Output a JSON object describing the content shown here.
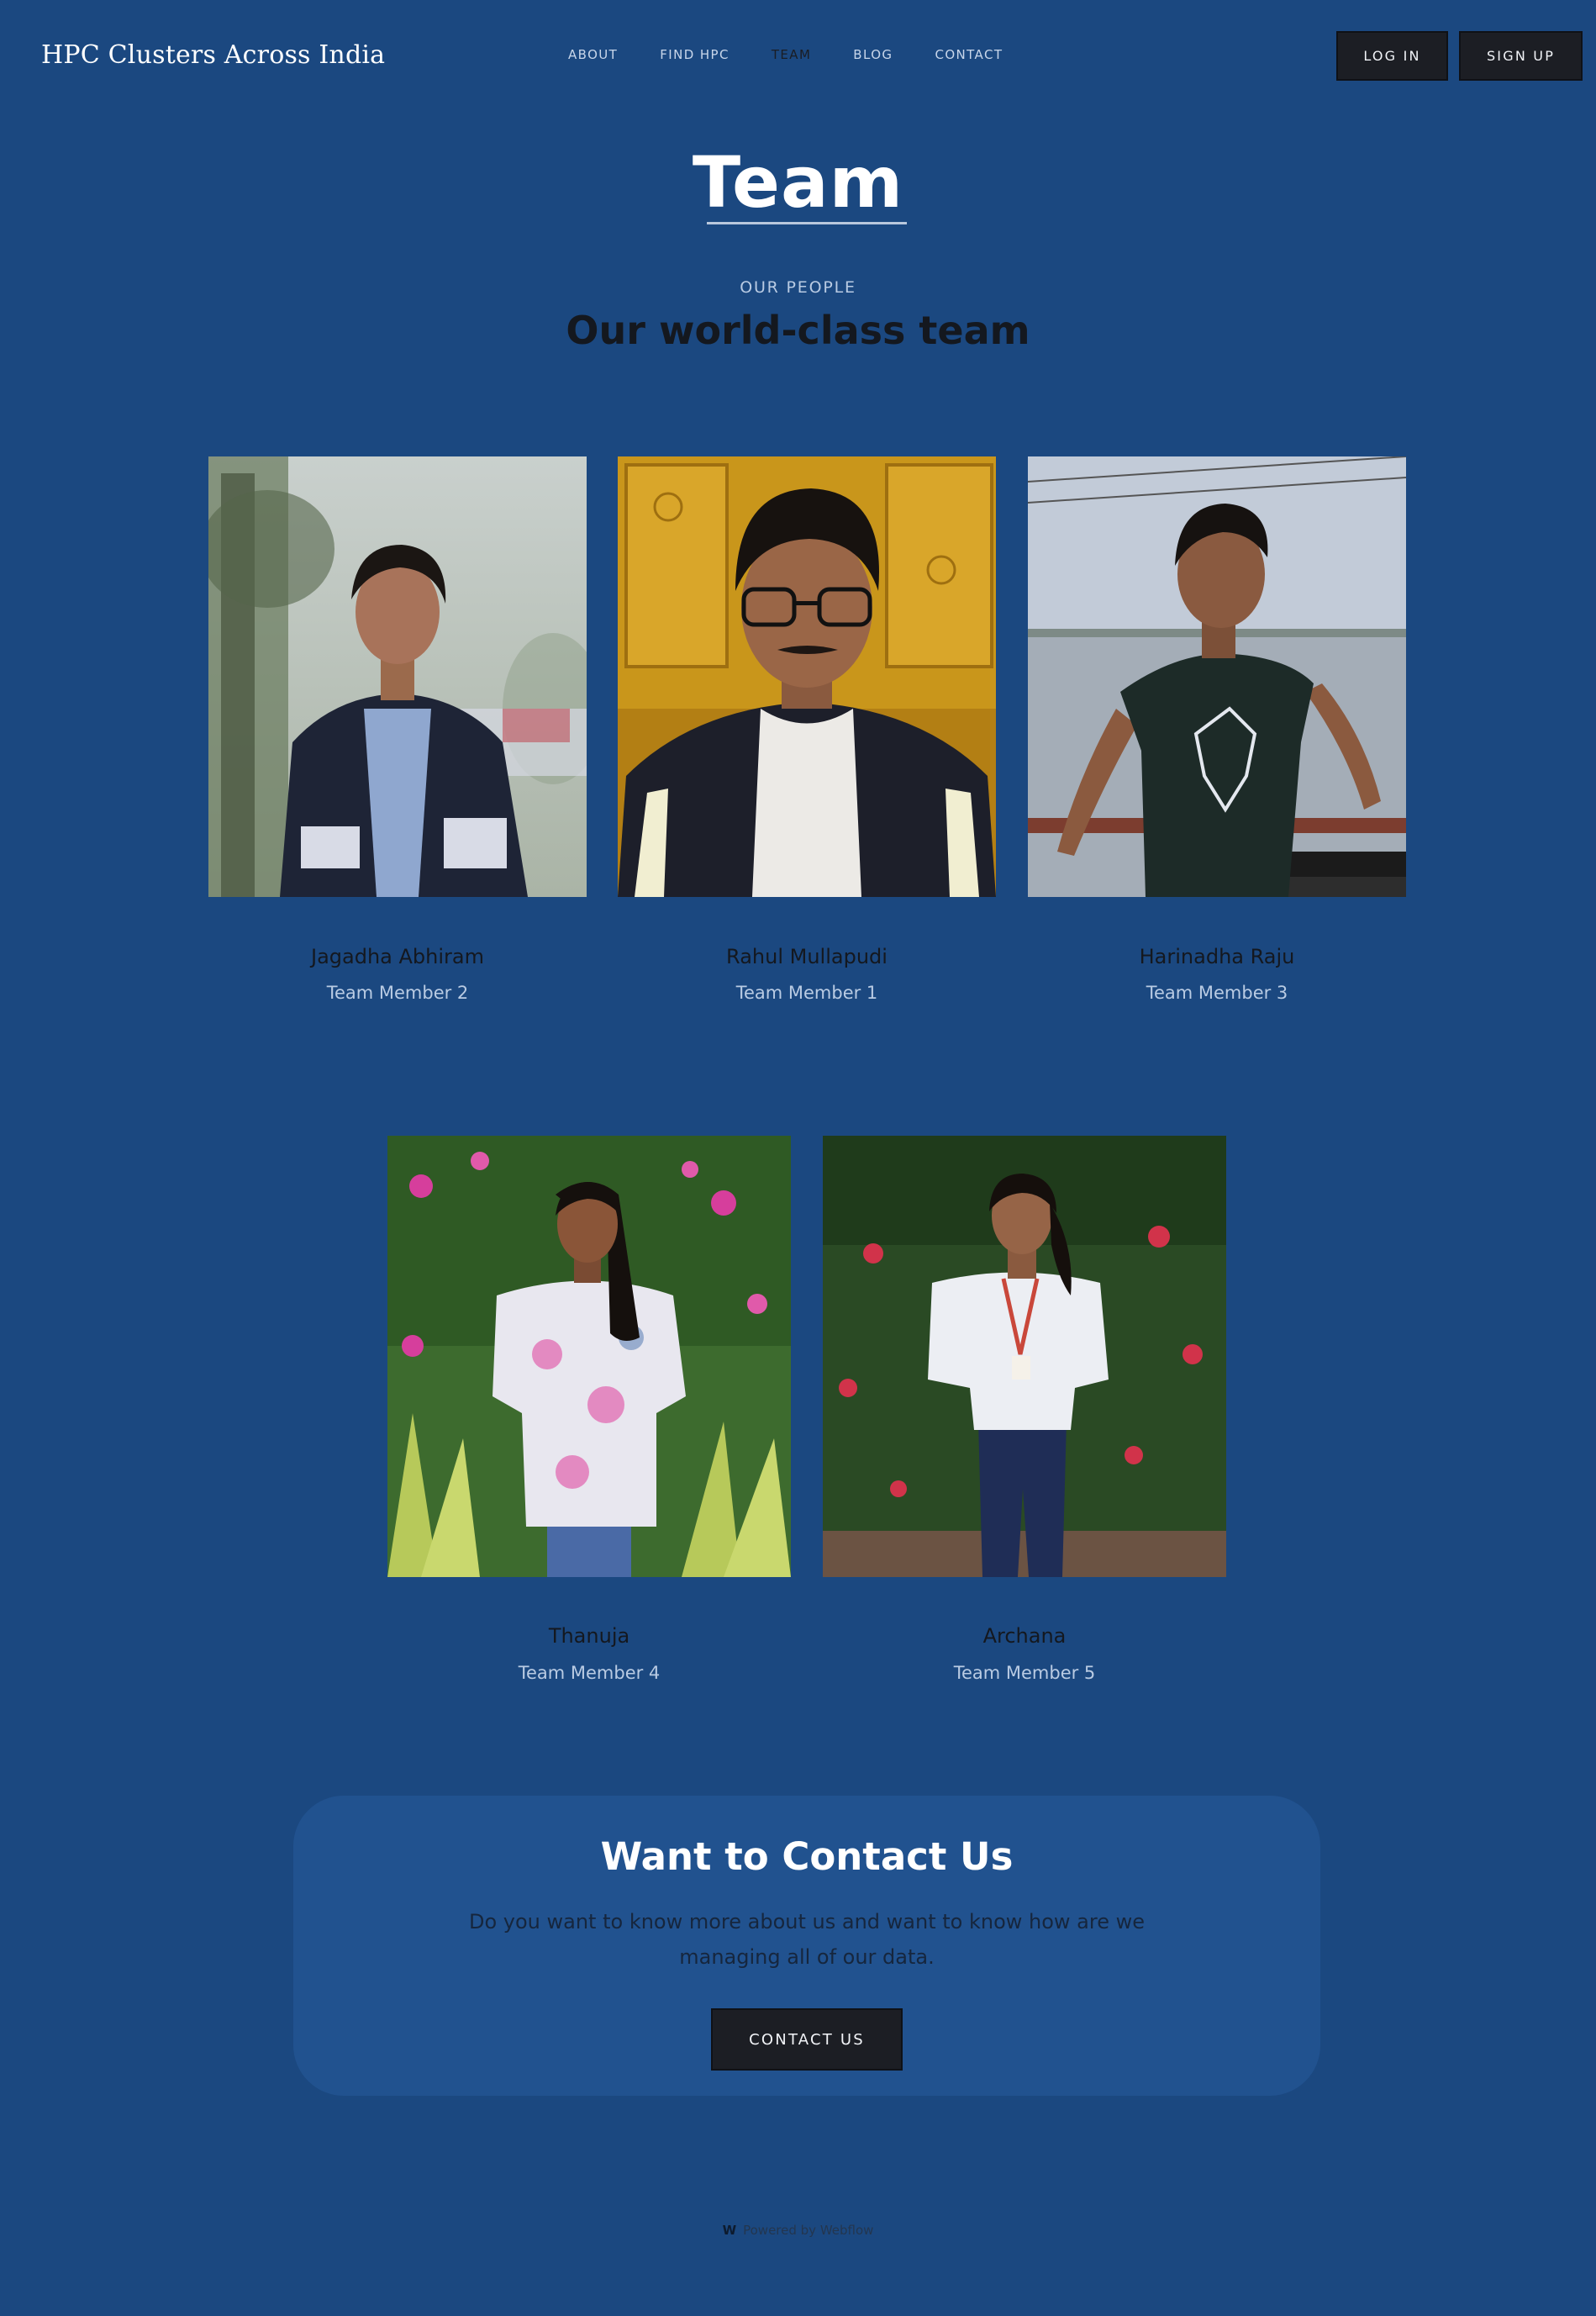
{
  "header": {
    "brand": "HPC Clusters Across India",
    "nav": [
      {
        "label": "ABOUT"
      },
      {
        "label": "FIND HPC"
      },
      {
        "label": "TEAM"
      },
      {
        "label": "BLOG"
      },
      {
        "label": "CONTACT"
      }
    ],
    "login_label": "LOG IN",
    "signup_label": "SIGN UP"
  },
  "hero": {
    "title": "Team",
    "eyebrow": "OUR PEOPLE",
    "subtitle": "Our world-class team"
  },
  "team": [
    {
      "name": "Jagadha Abhiram",
      "role": "Team Member 2"
    },
    {
      "name": "Rahul Mullapudi",
      "role": "Team Member 1"
    },
    {
      "name": "Harinadha Raju",
      "role": "Team Member 3"
    },
    {
      "name": "Thanuja",
      "role": "Team Member 4"
    },
    {
      "name": "Archana",
      "role": "Team Member 5"
    }
  ],
  "contact": {
    "title": "Want to Contact Us",
    "text": "Do you want to know more about us and want to know how are we managing all of our data.",
    "button_label": "CONTACT US"
  },
  "footer": {
    "logo_letter": "W",
    "text": "Powered by Webflow"
  },
  "colors": {
    "background": "#1b4880",
    "card": "#21528f",
    "button": "#1c1e24"
  }
}
